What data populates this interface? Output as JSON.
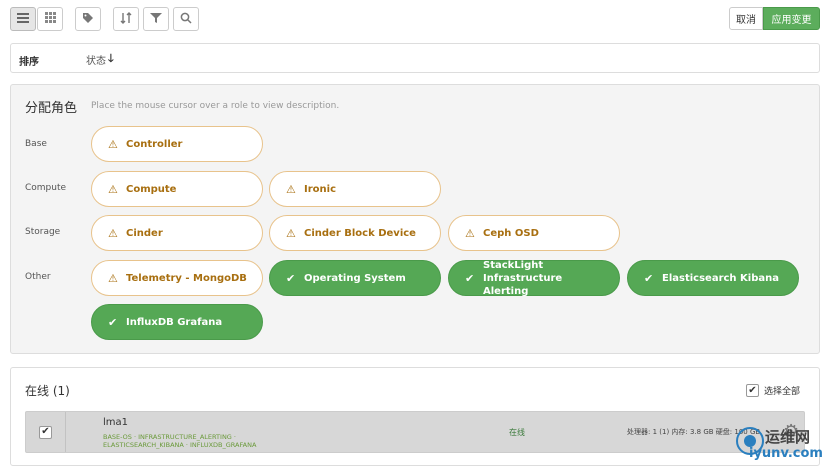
{
  "toolbar": {
    "icons": [
      "list-view-icon",
      "grid-view-icon",
      "tag-icon",
      "sort-icon",
      "filter-icon",
      "search-icon"
    ],
    "cancel_label": "取消",
    "apply_label": "应用变更",
    "apply_color": "#5cad5c"
  },
  "sortbar": {
    "label": "排序",
    "status_label": "状态",
    "arrow": "🡓"
  },
  "roles_panel": {
    "title": "分配角色",
    "hint": "Place the mouse cursor over a role to view description.",
    "groups": {
      "base": "Base",
      "compute": "Compute",
      "storage": "Storage",
      "other": "Other"
    },
    "roles": {
      "controller": "Controller",
      "compute": "Compute",
      "ironic": "Ironic",
      "cinder": "Cinder",
      "cinder_block_device": "Cinder Block Device",
      "ceph_osd": "Ceph OSD",
      "telemetry_mongodb": "Telemetry - MongoDB",
      "operating_system": "Operating System",
      "stacklight_alerting": "StackLight Infrastructure Alerting",
      "elasticsearch_kibana": "Elasticsearch Kibana",
      "influxdb_grafana": "InfluxDB Grafana"
    },
    "warn_color": "#a86f10",
    "ok_color": "#55a855"
  },
  "online": {
    "title": "在线 (1)",
    "select_all": "选择全部",
    "node": {
      "checked": true,
      "name": "lma1",
      "roles_line1": "BASE-OS · INFRASTRUCTURE_ALERTING ·",
      "roles_line2": "ELASTICSEARCH_KIBANA · INFLUXDB_GRAFANA",
      "status": "在线",
      "spec": "处理器: 1 (1) 内存: 3.8 GB 硬盘: 100 GB"
    }
  },
  "watermark": {
    "line1": "运维网",
    "line2": "iyunv.com"
  }
}
